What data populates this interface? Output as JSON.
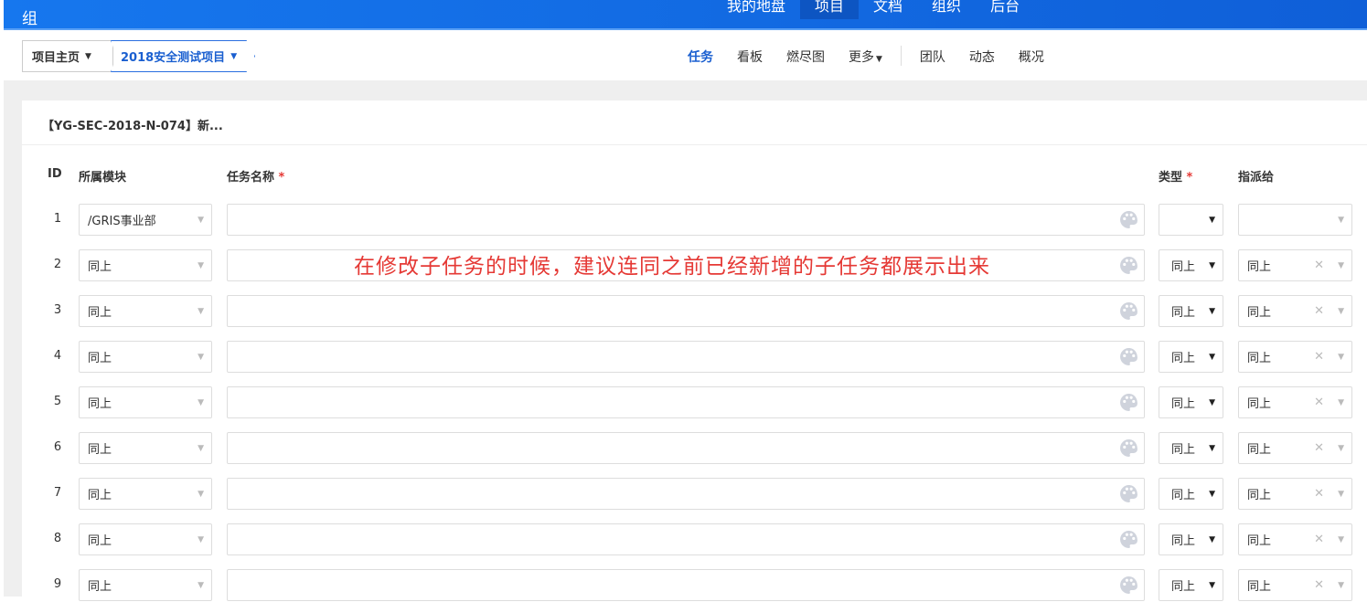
{
  "header": {
    "logo": "组",
    "nav": [
      "我的地盘",
      "项目",
      "文档",
      "组织",
      "后台"
    ],
    "active_nav": 1
  },
  "breadcrumb": {
    "home": "项目主页",
    "project": "2018安全测试项目"
  },
  "subnav": {
    "items": [
      "任务",
      "看板",
      "燃尽图",
      "更多"
    ],
    "items2": [
      "团队",
      "动态",
      "概况"
    ]
  },
  "card": {
    "title": "【YG-SEC-2018-N-074】新..."
  },
  "columns": {
    "id": "ID",
    "module": "所属模块",
    "name": "任务名称",
    "type": "类型",
    "assignee": "指派给"
  },
  "rows": [
    {
      "id": "1",
      "module": "/GRIS事业部",
      "type": "",
      "assignee": ""
    },
    {
      "id": "2",
      "module": "同上",
      "type": "同上",
      "assignee": "同上"
    },
    {
      "id": "3",
      "module": "同上",
      "type": "同上",
      "assignee": "同上"
    },
    {
      "id": "4",
      "module": "同上",
      "type": "同上",
      "assignee": "同上"
    },
    {
      "id": "5",
      "module": "同上",
      "type": "同上",
      "assignee": "同上"
    },
    {
      "id": "6",
      "module": "同上",
      "type": "同上",
      "assignee": "同上"
    },
    {
      "id": "7",
      "module": "同上",
      "type": "同上",
      "assignee": "同上"
    },
    {
      "id": "8",
      "module": "同上",
      "type": "同上",
      "assignee": "同上"
    },
    {
      "id": "9",
      "module": "同上",
      "type": "同上",
      "assignee": "同上"
    }
  ],
  "annotation": "在修改子任务的时候，建议连同之前已经新增的子任务都展示出来",
  "colors": {
    "accent": "#1a5fd0",
    "topbar": "#1677ee",
    "annotation": "#e53935"
  }
}
